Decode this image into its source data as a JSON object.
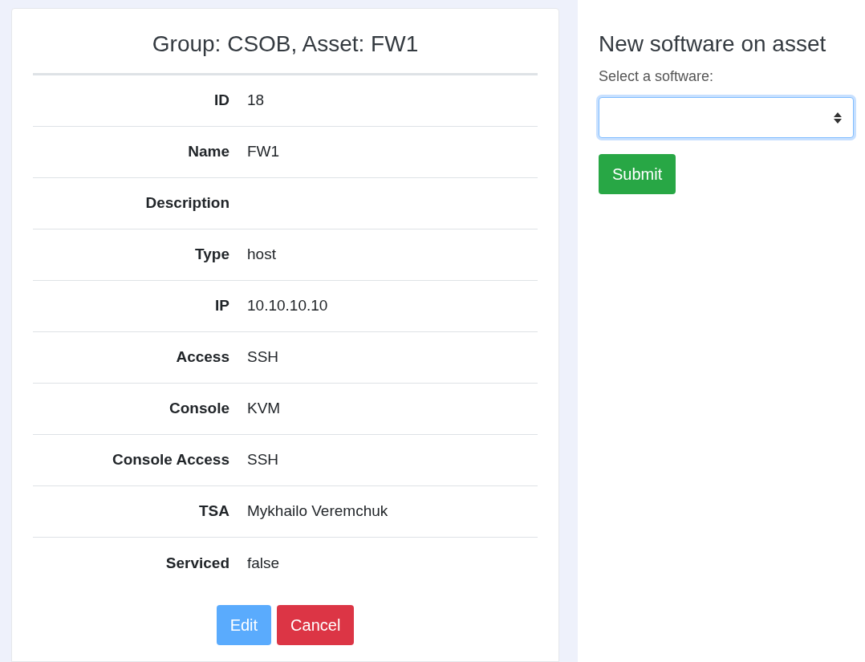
{
  "title": "Group: CSOB, Asset: FW1",
  "fields": [
    {
      "label": "ID",
      "value": "18"
    },
    {
      "label": "Name",
      "value": "FW1"
    },
    {
      "label": "Description"
    },
    {
      "label": "Type",
      "value": "host"
    },
    {
      "label": "IP",
      "value": "10.10.10.10"
    },
    {
      "label": "Access",
      "value": "SSH"
    },
    {
      "label": "Console",
      "value": "KVM"
    },
    {
      "label": "Console Access",
      "value": "SSH"
    },
    {
      "label": "TSA",
      "value": "Mykhailo Veremchuk"
    },
    {
      "label": "Serviced",
      "value": "false"
    }
  ],
  "buttons": [
    {
      "label": "Edit",
      "kind": "primary",
      "disabled": true
    },
    {
      "label": "Cancel",
      "kind": "danger",
      "disabled": false
    }
  ],
  "software_form": {
    "title": "New software on asset",
    "label": "Select a software:",
    "focused": true,
    "submit": "Submit"
  }
}
